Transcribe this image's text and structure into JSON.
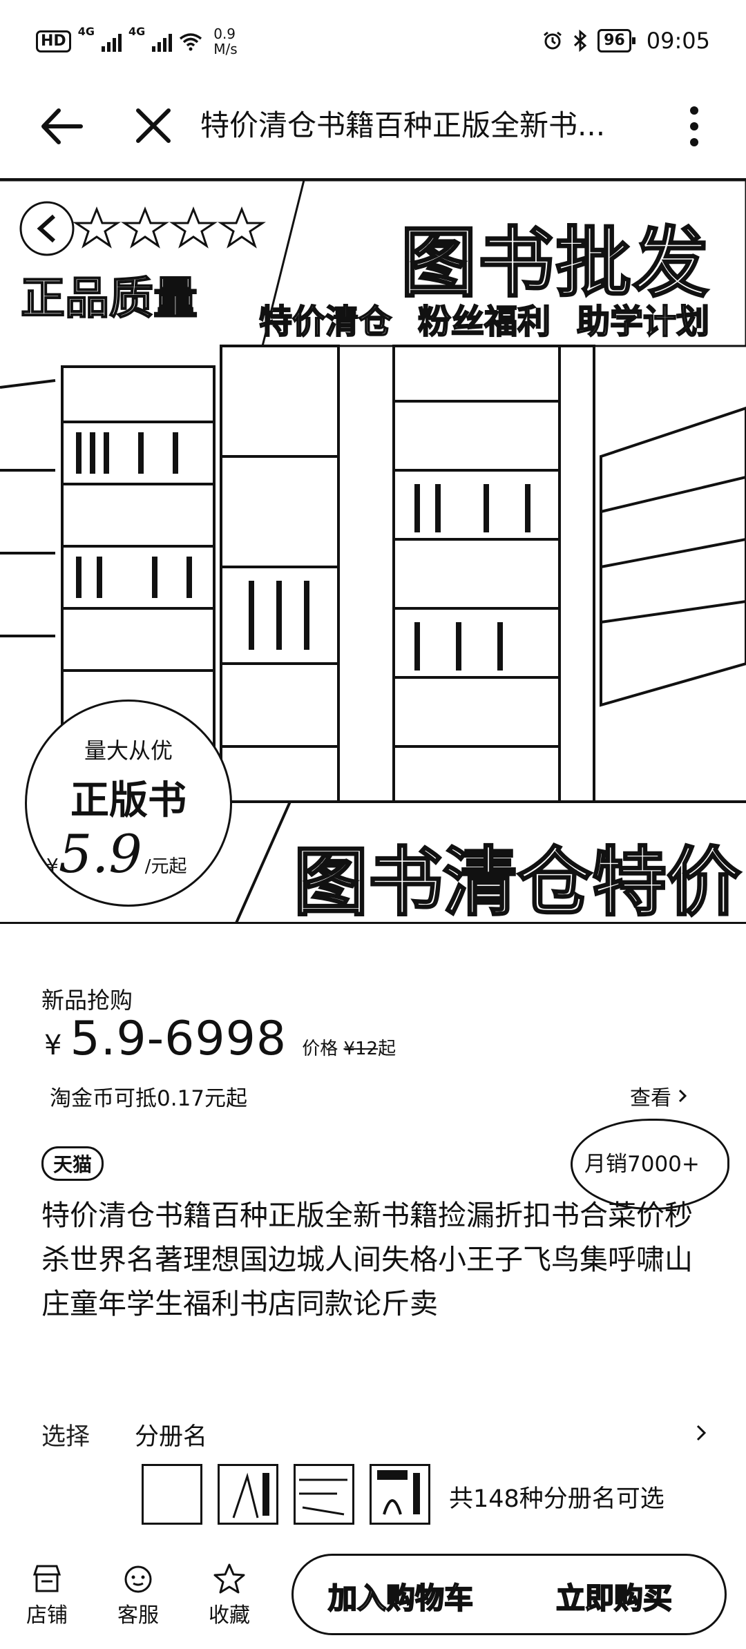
{
  "status_bar": {
    "badge": "HD",
    "net1": "4G",
    "net2": "4G",
    "speed_value": "0.9",
    "speed_unit": "M/s",
    "battery": "96",
    "time": "09:05"
  },
  "nav": {
    "title": "特价清仓书籍百种正版全新书..."
  },
  "hero": {
    "title": "图书批发",
    "quality": "正品质量",
    "tags": [
      "特价清仓",
      "粉丝福利",
      "助学计划"
    ],
    "bottom_title": "图书清仓特价",
    "badge_top": "量大从优",
    "badge_main": "正版书",
    "badge_yen": "¥",
    "badge_price": "5.9",
    "badge_unit": "/元起"
  },
  "pricing": {
    "promo_label": "新品抢购",
    "yen": "¥",
    "price_range": "5.9-6998",
    "orig_prefix": "价格 ",
    "orig_price": "¥12",
    "orig_suffix": "起",
    "coin_text": "淘金币可抵0.17元起",
    "view_label": "查看"
  },
  "product": {
    "tmall_badge": "天猫",
    "monthly_sales": "月销7000+",
    "title": "特价清仓书籍百种正版全新书籍捡漏折扣书合菜价秒杀世界名著理想国边城人间失格小王子飞鸟集呼啸山庄童年学生福利书店同款论斤卖"
  },
  "options": {
    "label": "选择",
    "value": "分册名",
    "variants_count": "共148种分册名可选"
  },
  "bottom_bar": {
    "shop": "店铺",
    "service": "客服",
    "favorite": "收藏",
    "add_cart": "加入购物车",
    "buy_now": "立即购买"
  },
  "colors": {
    "ink": "#111111",
    "background": "#ffffff"
  }
}
